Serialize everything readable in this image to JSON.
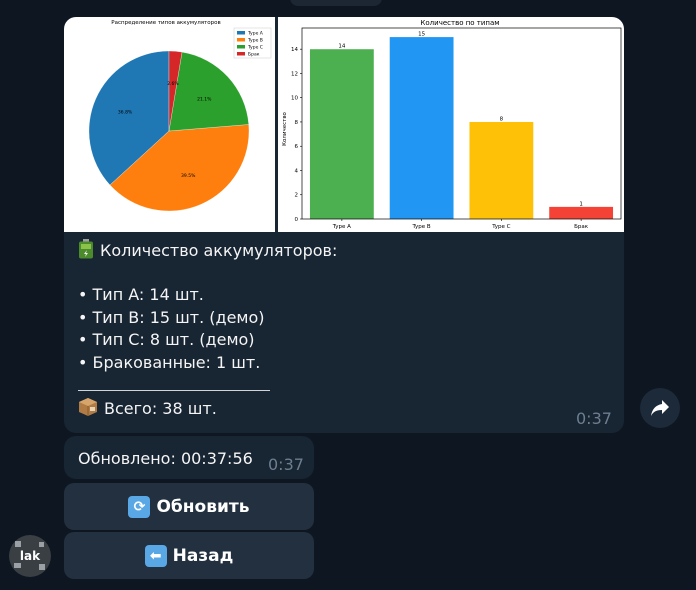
{
  "pie_chart": {
    "chart_data": {
      "type": "pie",
      "title": "Распределение типов аккумуляторов",
      "categories": [
        "Type A",
        "Type B",
        "Type C",
        "Брак"
      ],
      "values": [
        36.8,
        39.5,
        21.1,
        2.6
      ],
      "labels": [
        "36.8%",
        "39.5%",
        "21.1%",
        "2.6%"
      ],
      "colors": [
        "#1f77b4",
        "#ff7f0e",
        "#2ca02c",
        "#d62728"
      ],
      "legend": "top-right"
    }
  },
  "bar_chart": {
    "chart_data": {
      "type": "bar",
      "title": "Количество по типам",
      "categories": [
        "Type A",
        "Type B",
        "Type C",
        "Брак"
      ],
      "values": [
        14,
        15,
        8,
        1
      ],
      "colors": [
        "#4caf50",
        "#2196f3",
        "#ffc107",
        "#f44336"
      ],
      "ylabel": "Количество",
      "xlabel": "",
      "ylim": [
        0,
        15.75
      ],
      "yticks": [
        0,
        2,
        4,
        6,
        8,
        10,
        12,
        14
      ]
    }
  },
  "message": {
    "heading": "Количество аккумуляторов:",
    "lines": [
      "• Тип A: 14 шт.",
      "• Тип B: 15 шт. (демо)",
      "• Тип C: 8 шт. (демо)",
      "• Бракованные: 1 шт."
    ],
    "total": "Всего: 38 шт.",
    "time": "0:37",
    "battery_icon": "battery-icon",
    "box_icon": "package-icon"
  },
  "update_message": {
    "text": "Обновлено: 00:37:56",
    "time": "0:37"
  },
  "keyboard": {
    "refresh_label": "Обновить",
    "refresh_icon": "refresh-icon",
    "back_label": "Назад",
    "back_icon": "back-arrow-icon"
  },
  "avatar_text": "lak"
}
